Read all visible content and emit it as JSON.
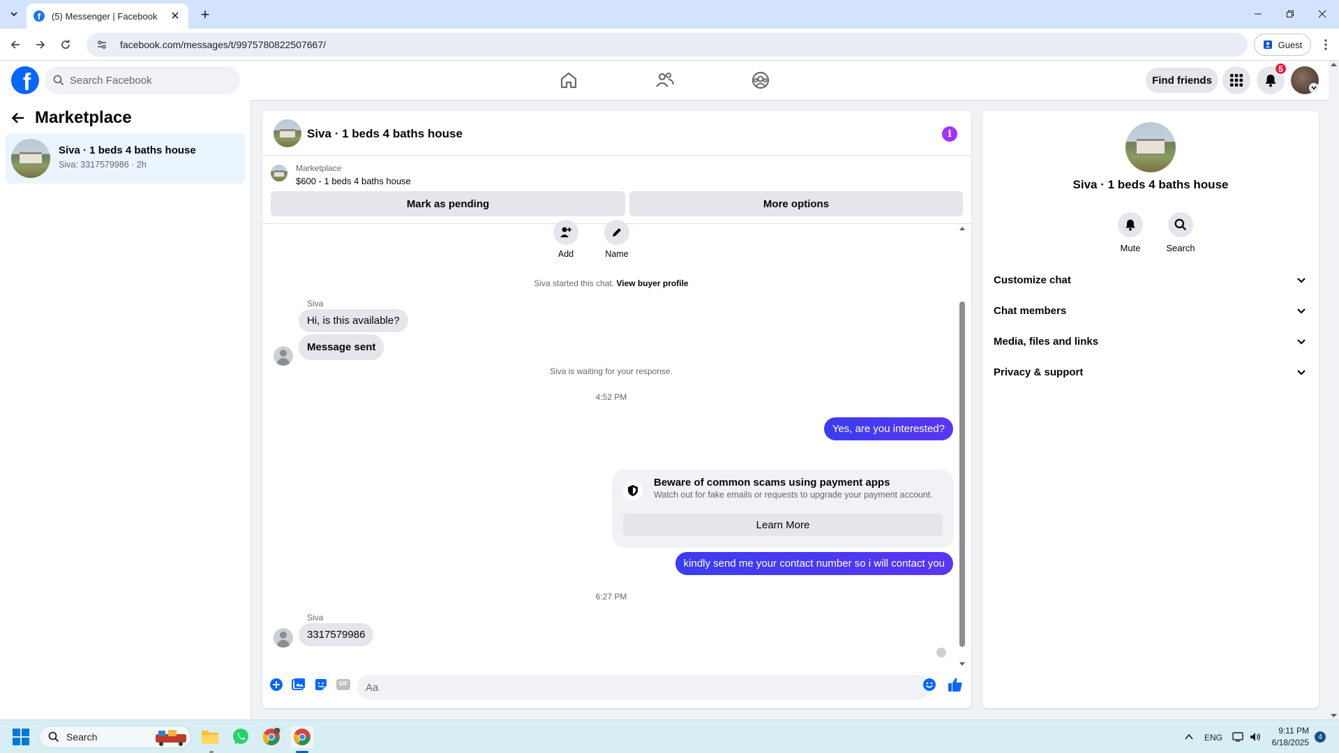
{
  "browser": {
    "tab_title": "(5) Messenger | Facebook",
    "url": "facebook.com/messages/t/9975780822507667/",
    "profile_label": "Guest"
  },
  "header": {
    "search_placeholder": "Search Facebook",
    "find_friends_label": "Find friends",
    "notification_count": "5"
  },
  "sidebar": {
    "title": "Marketplace",
    "conversation": {
      "name": "Siva · 1 beds 4 baths house",
      "preview": "Siva: 3317579986 · 2h"
    }
  },
  "chat": {
    "title": "Siva · 1 beds 4 baths house",
    "listing": {
      "label": "Marketplace",
      "title": "$600 - 1 beds 4 baths house",
      "mark_pending_label": "Mark as pending",
      "more_options_label": "More options"
    },
    "actions": {
      "add_label": "Add",
      "name_label": "Name"
    },
    "started_text": "Siva started this chat.",
    "view_buyer_label": "View buyer profile",
    "sender_name": "Siva",
    "messages_in_1": [
      "Hi, is this available?",
      "Message sent"
    ],
    "waiting_text": "Siva is waiting for your response.",
    "time_1": "4:52 PM",
    "out_1": "Yes, are you interested?",
    "scam": {
      "title": "Beware of common scams using payment apps",
      "body": "Watch out for fake emails or requests to upgrade your payment account.",
      "button": "Learn More"
    },
    "out_2": "kindly send me your contact number so i will contact you",
    "time_2": "6:27 PM",
    "sender_name_2": "Siva",
    "in_2": "3317579986",
    "composer_placeholder": "Aa",
    "gif_label": "GIF"
  },
  "right_panel": {
    "title": "Siva · 1 beds 4 baths house",
    "mute_label": "Mute",
    "search_label": "Search",
    "sections": [
      "Customize chat",
      "Chat members",
      "Media, files and links",
      "Privacy & support"
    ]
  },
  "taskbar": {
    "search_placeholder": "Search",
    "language": "ENG",
    "time": "9:11 PM",
    "date": "6/18/2025",
    "notification_count": "4"
  },
  "colors": {
    "facebook_blue": "#0866ff",
    "outgoing_bubble": "#4c3cf5",
    "info_purple": "#a033ff",
    "badge_red": "#e41e3f"
  }
}
